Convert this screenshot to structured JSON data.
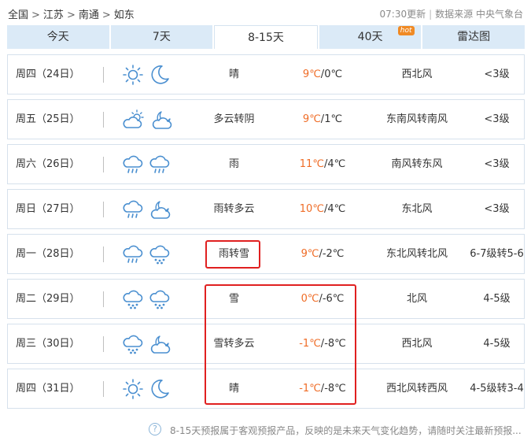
{
  "breadcrumb": {
    "items": [
      "全国",
      "江苏",
      "南通",
      "如东"
    ],
    "separator": ">"
  },
  "update": {
    "time": "07:30更新",
    "divider": "|",
    "source": "数据来源 中央气象台"
  },
  "tabs": [
    {
      "label": "今天",
      "active": false
    },
    {
      "label": "7天",
      "active": false
    },
    {
      "label": "8-15天",
      "active": true
    },
    {
      "label": "40天",
      "active": false,
      "badge": "hot"
    },
    {
      "label": "雷达图",
      "active": false
    }
  ],
  "colors": {
    "high_temp": "#ef6c26",
    "highlight_box": "#e02020",
    "tab_bg": "#dbeaf7",
    "row_border": "#d6e1ec"
  },
  "forecast": [
    {
      "day": "周四（24日）",
      "icon_day": "sun-icon",
      "icon_night": "moon-icon",
      "desc": "晴",
      "high": "9℃",
      "low": "0℃",
      "wind": "西北风",
      "level": "<3级"
    },
    {
      "day": "周五（25日）",
      "icon_day": "cloudy-day-icon",
      "icon_night": "cloudy-night-icon",
      "desc": "多云转阴",
      "high": "9℃",
      "low": "1℃",
      "wind": "东南风转南风",
      "level": "<3级"
    },
    {
      "day": "周六（26日）",
      "icon_day": "rain-icon",
      "icon_night": "rain-icon",
      "desc": "雨",
      "high": "11℃",
      "low": "4℃",
      "wind": "南风转东风",
      "level": "<3级"
    },
    {
      "day": "周日（27日）",
      "icon_day": "rain-icon",
      "icon_night": "cloudy-night-icon",
      "desc": "雨转多云",
      "high": "10℃",
      "low": "4℃",
      "wind": "东北风",
      "level": "<3级"
    },
    {
      "day": "周一（28日）",
      "icon_day": "rain-icon",
      "icon_night": "snow-icon",
      "desc": "雨转雪",
      "high": "9℃",
      "low": "-2℃",
      "wind": "东北风转北风",
      "level": "6-7级转5-6"
    },
    {
      "day": "周二（29日）",
      "icon_day": "snow-icon",
      "icon_night": "snow-icon",
      "desc": "雪",
      "high": "0℃",
      "low": "-6℃",
      "wind": "北风",
      "level": "4-5级"
    },
    {
      "day": "周三（30日）",
      "icon_day": "snow-icon",
      "icon_night": "cloudy-night-icon",
      "desc": "雪转多云",
      "high": "-1℃",
      "low": "-8℃",
      "wind": "西北风",
      "level": "4-5级"
    },
    {
      "day": "周四（31日）",
      "icon_day": "sun-icon",
      "icon_night": "moon-icon",
      "desc": "晴",
      "high": "-1℃",
      "low": "-8℃",
      "wind": "西北风转西风",
      "level": "4-5级转3-4"
    }
  ],
  "footer": {
    "help_symbol": "?",
    "note": "8-15天预报属于客观预报产品，反映的是未来天气变化趋势，请随时关注最新预报..."
  }
}
